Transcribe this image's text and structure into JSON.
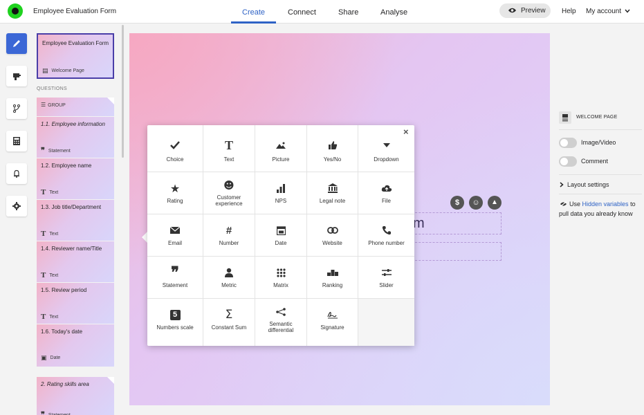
{
  "header": {
    "form_title": "Employee Evaluation Form",
    "tabs": [
      {
        "label": "Create",
        "active": true
      },
      {
        "label": "Connect",
        "active": false
      },
      {
        "label": "Share",
        "active": false
      },
      {
        "label": "Analyse",
        "active": false
      }
    ],
    "preview_label": "Preview",
    "help_label": "Help",
    "account_label": "My account",
    "accent_color": "#2e62c5"
  },
  "rail": {
    "icons": [
      "pencil-icon",
      "paint-icon",
      "branch-icon",
      "calculator-icon",
      "bell-icon",
      "gear-icon"
    ]
  },
  "sidebar": {
    "welcome_card": {
      "title": "Employee Evaluation Form",
      "type_label": "Welcome Page"
    },
    "questions_label": "QUESTIONS",
    "group_label": "GROUP",
    "items": [
      {
        "title": "1.1. Employee information",
        "type": "Statement"
      },
      {
        "title": "1.2. Employee name",
        "type": "Text"
      },
      {
        "title": "1.3. Job title/Department",
        "type": "Text"
      },
      {
        "title": "1.4. Reviewer name/Title",
        "type": "Text"
      },
      {
        "title": "1.5. Review period",
        "type": "Text"
      },
      {
        "title": "1.6. Today's date",
        "type": "Date"
      },
      {
        "title": "2. Rating skills area",
        "type": "Statement"
      }
    ]
  },
  "canvas": {
    "visible_text": "m",
    "icons": [
      "dollar-icon",
      "smiley-icon",
      "image-icon"
    ]
  },
  "question_types": {
    "close_label": "×",
    "rows": [
      [
        "Choice",
        "Text",
        "Picture",
        "Yes/No",
        "Dropdown"
      ],
      [
        "Rating",
        "Customer experience",
        "NPS",
        "Legal note",
        "File"
      ],
      [
        "Email",
        "Number",
        "Date",
        "Website",
        "Phone number"
      ],
      [
        "Statement",
        "Metric",
        "Matrix",
        "Ranking",
        "Slider"
      ],
      [
        "Numbers scale",
        "Constant Sum",
        "Semantic differential",
        "Signature",
        ""
      ]
    ]
  },
  "right_panel": {
    "welcome_page_label": "WELCOME PAGE",
    "image_video_label": "Image/Video",
    "comment_label": "Comment",
    "layout_settings_label": "Layout settings",
    "hidden_vars_prefix": "Use ",
    "hidden_vars_link": "Hidden variables",
    "hidden_vars_suffix": " to",
    "hidden_vars_line2": "pull data you already know"
  }
}
